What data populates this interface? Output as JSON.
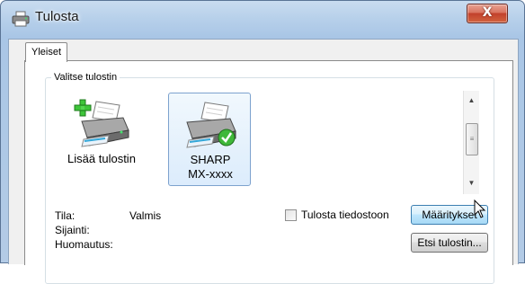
{
  "window": {
    "title": "Tulosta",
    "title_icon": "printer-icon",
    "close_icon": "close-icon",
    "close_glyph": "X"
  },
  "tabs": [
    {
      "label": "Yleiset",
      "active": true
    }
  ],
  "printer_group": {
    "title": "Valitse tulostin",
    "printers": [
      {
        "name": "Lisää tulostin",
        "icon": "add-printer-icon",
        "selected": false
      },
      {
        "name_line1": "SHARP",
        "name_line2": "MX-xxxx",
        "icon": "default-printer-icon",
        "selected": true
      }
    ]
  },
  "status": {
    "tila_label": "Tila:",
    "tila_value": "Valmis",
    "sijainti_label": "Sijainti:",
    "huomautus_label": "Huomautus:"
  },
  "print_to_file": {
    "label": "Tulosta tiedostoon",
    "checked": false
  },
  "buttons": {
    "preferences": "Määritykset",
    "find_printer": "Etsi tulostin..."
  },
  "colors": {
    "selection_border": "#7da2ce",
    "close_button": "#c2412b",
    "window_frame": "#b7d0ea"
  }
}
